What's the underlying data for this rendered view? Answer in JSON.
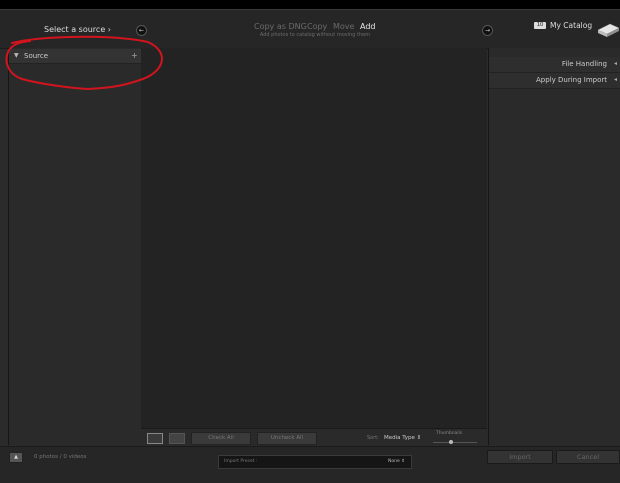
{
  "header": {
    "source_label": "Select a source",
    "source_chevron": "›",
    "left_arrow": "←",
    "right_arrow": "→",
    "modes": [
      "Copy as DNG",
      "Copy",
      "Move",
      "Add"
    ],
    "active_mode": "Add",
    "mode_subtitle": "Add photos to catalog without moving them",
    "catalog_badge": "10",
    "catalog_label": "My Catalog"
  },
  "left_panel": {
    "source_title": "Source",
    "source_toggle": "▼",
    "source_add": "+"
  },
  "toolbar": {
    "check_all": "Check All",
    "uncheck_all": "Uncheck All",
    "sort_label": "Sort:",
    "sort_value": "Media Type ⇕",
    "thumbnails_label": "Thumbnails",
    "thumbnail_size": 0.4
  },
  "right_panel": {
    "file_handling": "File Handling",
    "apply_during_import": "Apply During Import",
    "collapse_glyph": "◂"
  },
  "footer": {
    "expand_glyph": "▲",
    "count_label": "0 photos / 0 videos",
    "import_preset_label": "Import Preset :",
    "import_preset_value": "None ⇕",
    "import_button": "Import",
    "cancel_button": "Cancel"
  },
  "annotation": {
    "color": "#d2141e"
  }
}
